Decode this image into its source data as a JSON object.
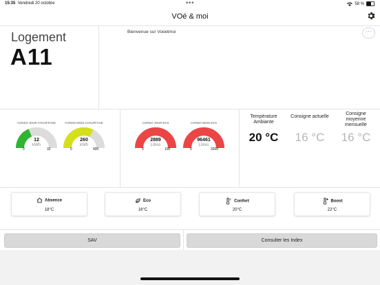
{
  "status_bar": {
    "time": "15:35",
    "date": "Vendredi 20 octobre",
    "battery": "58 %"
  },
  "header": {
    "title": "VOé & moi"
  },
  "logement": {
    "label": "Logement",
    "value": "A11"
  },
  "welcome": "Bienvenue sur Voeetmoi",
  "gauges": [
    {
      "title": "CONSO JOUR CHAUFFAGE",
      "value": "12",
      "unit": "kWh",
      "min": "0",
      "max": "32",
      "fraction": 0.375,
      "color": "#2fb52f"
    },
    {
      "title": "CONSO MOIS CHAUFFAGE",
      "value": "260",
      "unit": "kWh",
      "min": "0",
      "max": "400",
      "fraction": 0.65,
      "color": "#d5e01b"
    },
    {
      "title": "CONSO JOUR ECS",
      "value": "2889",
      "unit": "Litres",
      "min": "0",
      "max": "100",
      "fraction": 1.0,
      "color": "#ec4545"
    },
    {
      "title": "CONSO MOIS ECS",
      "value": "96461",
      "unit": "Litres",
      "min": "0",
      "max": "3200",
      "fraction": 1.0,
      "color": "#ec4545"
    }
  ],
  "temperatures": [
    {
      "label": "Température Ambiante",
      "value": "20 °C"
    },
    {
      "label": "Consigne actuelle",
      "value": "16 °C"
    },
    {
      "label": "Consigne moyenne mensuelle",
      "value": "16 °C"
    }
  ],
  "modes": [
    {
      "name": "Absence",
      "temp": "18°C",
      "icon": "house-icon"
    },
    {
      "name": "Eco",
      "temp": "16°C",
      "icon": "leaf-icon"
    },
    {
      "name": "Confort",
      "temp": "20°C",
      "icon": "thermometer-icon"
    },
    {
      "name": "Boost",
      "temp": "22°C",
      "icon": "thermometer-plus-icon"
    }
  ],
  "footer": {
    "sav": "SAV",
    "index": "Consulter les Index"
  },
  "colors": {
    "gauge_track": "#dcdcdc",
    "temp_value_muted": "#b5b5b5"
  }
}
